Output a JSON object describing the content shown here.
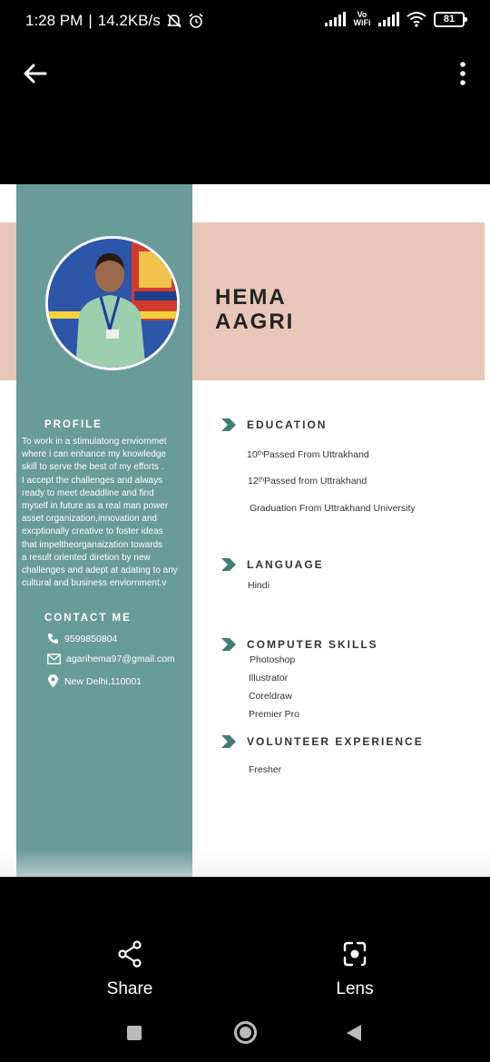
{
  "status": {
    "time": "1:28 PM",
    "speed": "14.2KB/s",
    "vowifi": "Vo WiFi",
    "battery": "81"
  },
  "resume": {
    "first_name": "HEMA",
    "last_name": "AAGRI",
    "profile_title": "PROFILE",
    "profile_lines": [
      "To work in a stimulatong enviornmet",
      "where i can enhance my knowledge",
      "skill to serve the best of my efforts .",
      "I accept the challenges and always",
      "ready to meet deaddline and find",
      "myself in future as a real man power",
      "asset organization,innovation and",
      "excptionally creative to foster ideas",
      "that impeltheorganaization towards",
      "a result oriented diretion by new",
      "challenges and adept at adating to any",
      "cultural and business enviornment.v"
    ],
    "contact_title": "CONTACT ME",
    "phone": "9599850804",
    "email": "agarihema97@gmail.com",
    "address": "New Delhi,110001",
    "education_title": "EDUCATION",
    "education_items": [
      "10ᵗʰPassed From Uttrakhand",
      "12ᵗʰPassed from Uttrakhand",
      "Graduation From Uttrakhand University"
    ],
    "language_title": "LANGUAGE",
    "language_items": [
      "Hindi"
    ],
    "skills_title": "COMPUTER SKILLS",
    "skills_items": [
      "Photoshop",
      "Illustrator",
      "Coreldraw",
      "Premier Pro"
    ],
    "volunteer_title": "VOLUNTEER EXPERIENCE",
    "volunteer_items": [
      "Fresher"
    ]
  },
  "actions": {
    "share_label": "Share",
    "lens_label": "Lens"
  },
  "colors": {
    "teal": "#699b99",
    "pink": "#e8c7b9",
    "arrow": "#3f7c78"
  }
}
